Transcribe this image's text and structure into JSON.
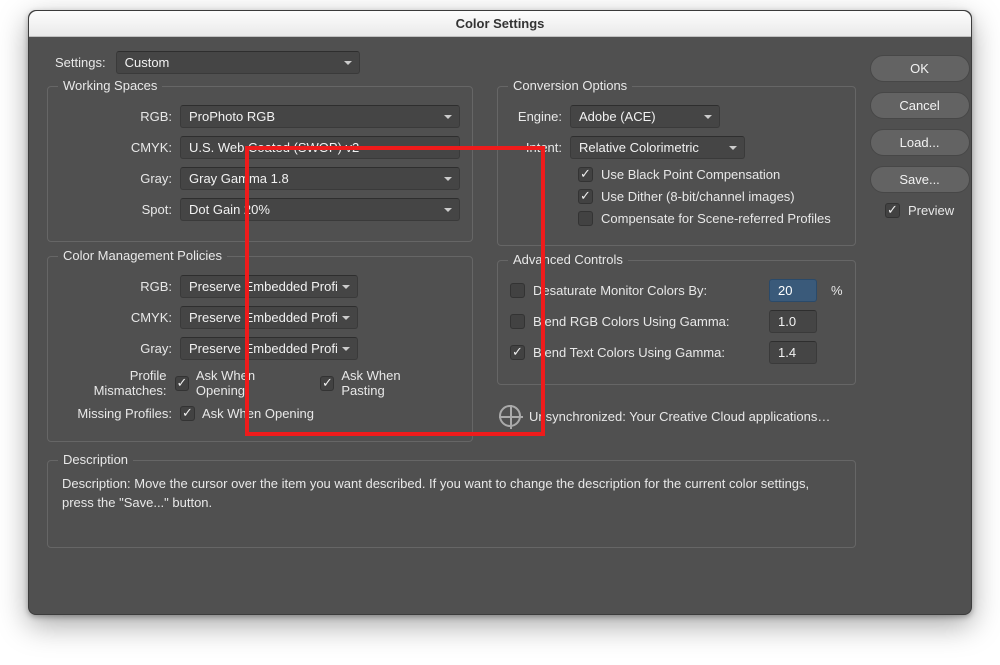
{
  "title": "Color Settings",
  "settings": {
    "label": "Settings:",
    "value": "Custom"
  },
  "workingSpaces": {
    "legend": "Working Spaces",
    "rgb": {
      "label": "RGB:",
      "value": "ProPhoto RGB"
    },
    "cmyk": {
      "label": "CMYK:",
      "value": "U.S. Web Coated (SWOP) v2"
    },
    "gray": {
      "label": "Gray:",
      "value": "Gray Gamma 1.8"
    },
    "spot": {
      "label": "Spot:",
      "value": "Dot Gain 20%"
    }
  },
  "colorManagement": {
    "legend": "Color Management Policies",
    "rgb": {
      "label": "RGB:",
      "value": "Preserve Embedded Profiles"
    },
    "cmyk": {
      "label": "CMYK:",
      "value": "Preserve Embedded Profiles"
    },
    "gray": {
      "label": "Gray:",
      "value": "Preserve Embedded Profiles"
    },
    "mismatchLabel": "Profile Mismatches:",
    "askOpen": "Ask When Opening",
    "askPaste": "Ask When Pasting",
    "missingLabel": "Missing Profiles:",
    "askOpenMissing": "Ask When Opening"
  },
  "conversion": {
    "legend": "Conversion Options",
    "engine": {
      "label": "Engine:",
      "value": "Adobe (ACE)"
    },
    "intent": {
      "label": "Intent:",
      "value": "Relative Colorimetric"
    },
    "blackPoint": "Use Black Point Compensation",
    "dither": "Use Dither (8-bit/channel images)",
    "sceneRef": "Compensate for Scene-referred Profiles"
  },
  "advanced": {
    "legend": "Advanced Controls",
    "desat": {
      "label": "Desaturate Monitor Colors By:",
      "value": "20",
      "unit": "%"
    },
    "blendRGB": {
      "label": "Blend RGB Colors Using Gamma:",
      "value": "1.00"
    },
    "blendText": {
      "label": "Blend Text Colors Using Gamma:",
      "value": "1.45"
    }
  },
  "sync": "Unsynchronized: Your Creative Cloud applications…",
  "description": {
    "legend": "Description",
    "text": "Description:  Move the cursor over the item you want described.  If you want to change the description for the current color settings, press the \"Save...\" button."
  },
  "buttons": {
    "ok": "OK",
    "cancel": "Cancel",
    "load": "Load...",
    "save": "Save...",
    "preview": "Preview"
  }
}
